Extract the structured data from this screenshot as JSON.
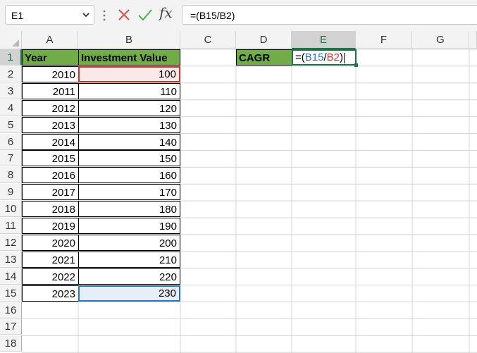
{
  "formula_bar": {
    "name_box": "E1",
    "fx_label": "fx",
    "formula": "=(B15/B2)"
  },
  "columns": [
    "A",
    "B",
    "C",
    "D",
    "E",
    "F",
    "G"
  ],
  "rows": [
    "1",
    "2",
    "3",
    "4",
    "5",
    "6",
    "7",
    "8",
    "9",
    "10",
    "11",
    "12",
    "13",
    "14",
    "15",
    "16",
    "17",
    "18"
  ],
  "table": {
    "header_year": "Year",
    "header_value": "Investment Value",
    "years": [
      "2010",
      "2011",
      "2012",
      "2013",
      "2014",
      "2015",
      "2016",
      "2017",
      "2018",
      "2019",
      "2020",
      "2021",
      "2022",
      "2023"
    ],
    "values": [
      "100",
      "110",
      "120",
      "130",
      "140",
      "150",
      "160",
      "170",
      "180",
      "190",
      "200",
      "210",
      "220",
      "230"
    ]
  },
  "cagr": {
    "label": "CAGR",
    "formula_prefix": "=(",
    "ref1": "B15",
    "sep": "/",
    "ref2": "B2",
    "suffix": ")"
  },
  "colors": {
    "header_fill": "#70ad47",
    "ref_blue": "#2e75b6",
    "ref_red": "#c0392b",
    "active_green": "#1e7145"
  }
}
